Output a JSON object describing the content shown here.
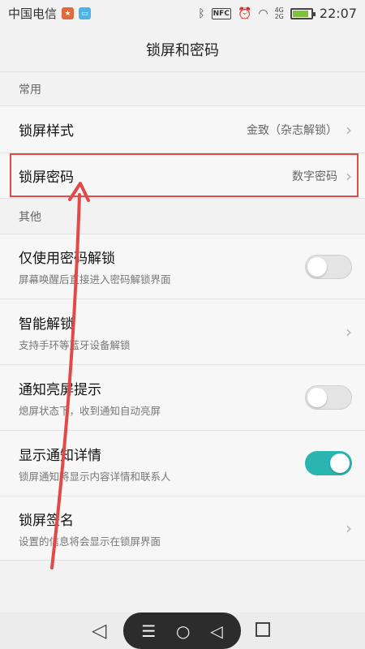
{
  "status_bar": {
    "carrier": "中国电信",
    "time": "22:07",
    "nfc": "NFC",
    "net_top": "4G",
    "net_bottom": "2G",
    "icons": [
      "app-icon-1",
      "app-icon-2",
      "bluetooth-icon",
      "nfc-icon",
      "alarm-icon",
      "wifi-icon",
      "signal-icon",
      "battery-icon"
    ]
  },
  "header": {
    "title": "锁屏和密码"
  },
  "sections": {
    "common": "常用",
    "other": "其他"
  },
  "rows": {
    "lock_style": {
      "title": "锁屏样式",
      "value": "金致（杂志解锁）"
    },
    "lock_password": {
      "title": "锁屏密码",
      "value": "数字密码"
    },
    "password_only": {
      "title": "仅使用密码解锁",
      "subtitle": "屏幕唤醒后直接进入密码解锁界面",
      "toggle_on": false
    },
    "smart_unlock": {
      "title": "智能解锁",
      "subtitle": "支持手环等蓝牙设备解锁"
    },
    "notify_wake": {
      "title": "通知亮屏提示",
      "subtitle": "熄屏状态下，收到通知自动亮屏",
      "toggle_on": false
    },
    "show_details": {
      "title": "显示通知详情",
      "subtitle": "锁屏通知将显示内容详情和联系人",
      "toggle_on": true
    },
    "signature": {
      "title": "锁屏签名",
      "subtitle": "设置的信息将会显示在锁屏界面"
    }
  },
  "colors": {
    "accent_toggle": "#2bb5b1",
    "annotation": "#e24a4a"
  }
}
